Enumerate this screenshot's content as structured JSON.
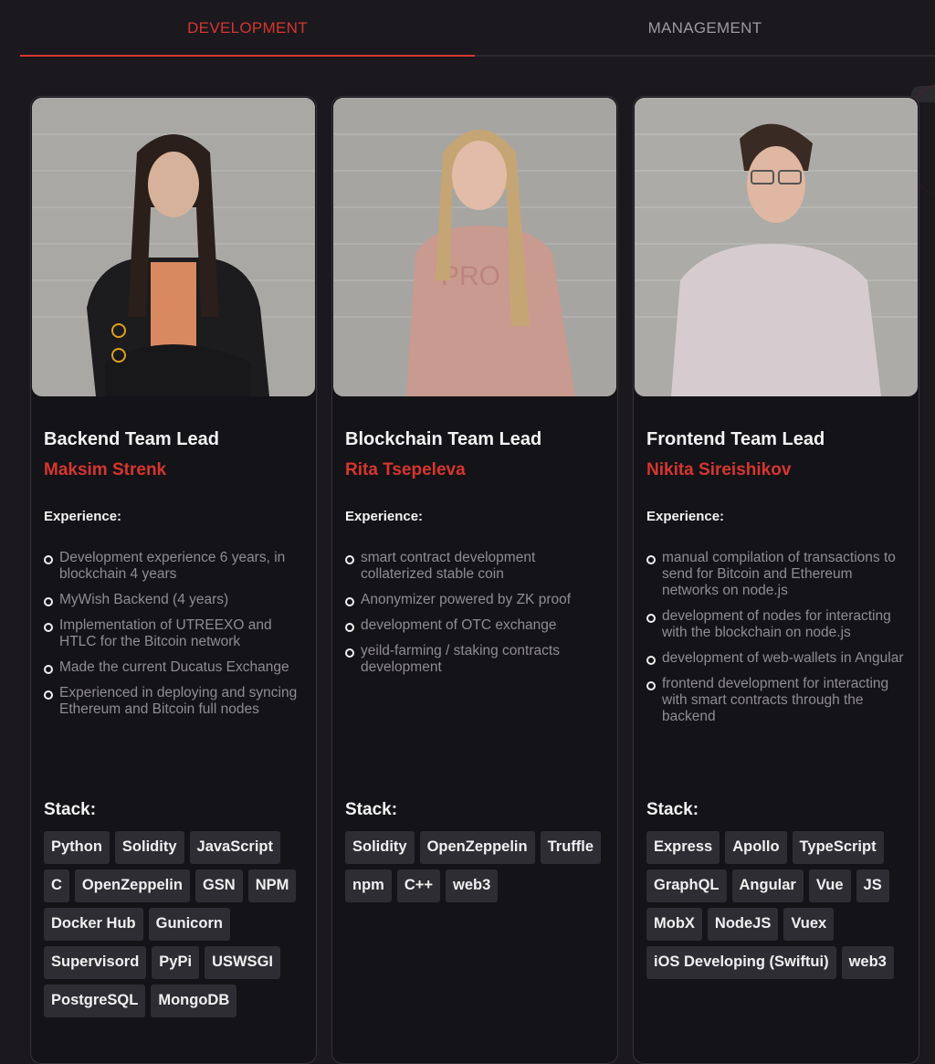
{
  "tabs": [
    {
      "label": "DEVELOPMENT",
      "active": true
    },
    {
      "label": "MANAGEMENT",
      "active": false
    }
  ],
  "colors": {
    "accent": "#d6362f",
    "background": "#1b191e",
    "card": "#141317",
    "chip": "#2e2d33"
  },
  "experience_label": "Experience:",
  "stack_label": "Stack:",
  "members": [
    {
      "role": "Backend Team Lead",
      "name": "Maksim Strenk",
      "photo": "portrait-long-haired-man-arms-crossed",
      "experience": [
        "Development experience 6 years, in blockchain 4 years",
        "MyWish Backend (4 years)",
        "Implementation of UTREEXO and HTLC for the Bitcoin network",
        "Made the current Ducatus Exchange",
        "Experienced in deploying and syncing Ethereum and Bitcoin full nodes"
      ],
      "stack": [
        "Python",
        "Solidity",
        "JavaScript",
        "C",
        "OpenZeppelin",
        "GSN",
        "NPM",
        "Docker Hub",
        "Gunicorn",
        "Supervisord",
        "PyPi",
        "USWSGI",
        "PostgreSQL",
        "MongoDB"
      ]
    },
    {
      "role": "Blockchain Team Lead",
      "name": "Rita Tsepeleva",
      "photo": "portrait-blonde-woman-pink-sweatshirt",
      "experience": [
        "smart contract development collaterized stable coin",
        "Anonymizer powered by ZK proof",
        "development of OTC exchange",
        "yeild-farming / staking contracts development"
      ],
      "stack": [
        "Solidity",
        "OpenZeppelin",
        "Truffle",
        "npm",
        "C++",
        "web3"
      ]
    },
    {
      "role": "Frontend Team Lead",
      "name": "Nikita Sireishikov",
      "photo": "portrait-man-glasses-polo-shirt",
      "experience": [
        "manual compilation of transactions to send for Bitcoin and Ethereum networks on node.js",
        "development of nodes for interacting with the blockchain on node.js",
        "development of web-wallets in Angular",
        "frontend development for interacting with smart contracts through the backend"
      ],
      "stack": [
        "Express",
        "Apollo",
        "TypeScript",
        "GraphQL",
        "Angular",
        "Vue",
        "JS",
        "MobX",
        "NodeJS",
        "Vuex",
        "iOS Developing (Swiftui)",
        "web3"
      ]
    }
  ]
}
